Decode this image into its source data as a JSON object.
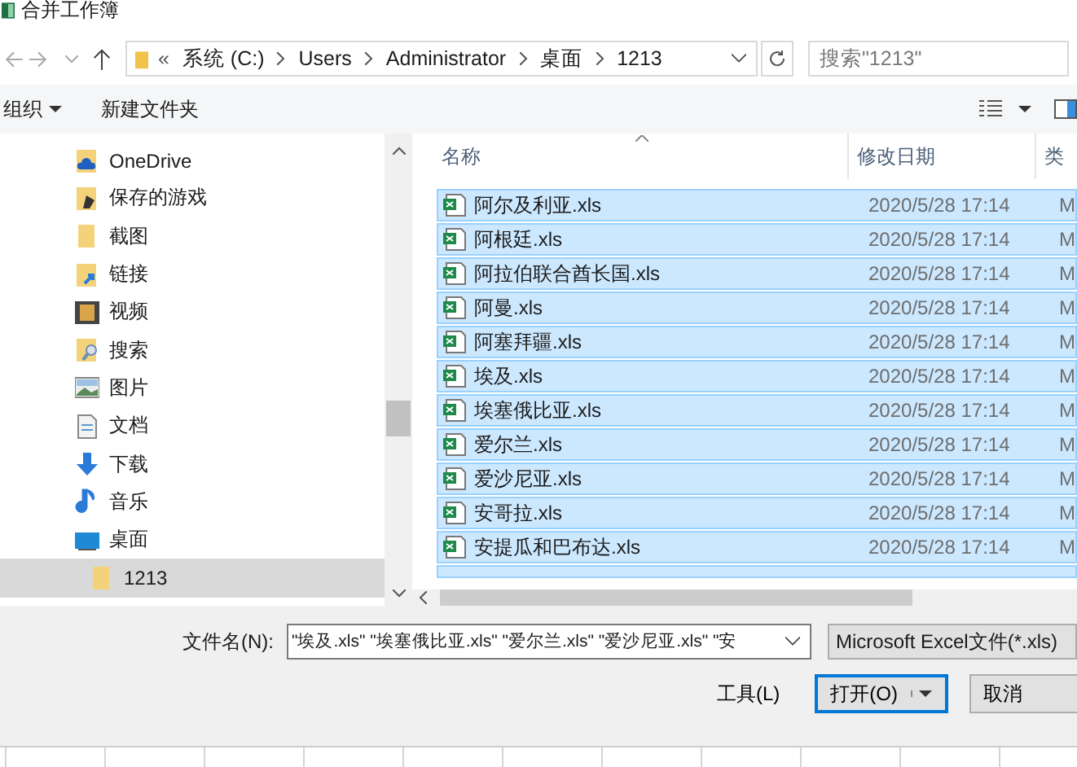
{
  "window": {
    "title": "合并工作簿"
  },
  "address": {
    "crumbs": [
      "«",
      "系统 (C:)",
      "Users",
      "Administrator",
      "桌面",
      "1213"
    ]
  },
  "search": {
    "placeholder": "搜索\"1213\""
  },
  "toolbar": {
    "organize": "组织",
    "new_folder": "新建文件夹"
  },
  "sidebar": {
    "items": [
      {
        "label": "OneDrive",
        "selected": false
      },
      {
        "label": "保存的游戏",
        "selected": false
      },
      {
        "label": "截图",
        "selected": false
      },
      {
        "label": "链接",
        "selected": false
      },
      {
        "label": "视频",
        "selected": false
      },
      {
        "label": "搜索",
        "selected": false
      },
      {
        "label": "图片",
        "selected": false
      },
      {
        "label": "文档",
        "selected": false
      },
      {
        "label": "下载",
        "selected": false
      },
      {
        "label": "音乐",
        "selected": false
      },
      {
        "label": "桌面",
        "selected": false,
        "children": [
          {
            "label": "1213",
            "selected": true
          }
        ]
      }
    ]
  },
  "table": {
    "columns": [
      "名称",
      "修改日期",
      "类"
    ],
    "rows": [
      {
        "name": "阿尔及利亚.xls",
        "date": "2020/5/28 17:14",
        "column_3": "M",
        "selected": true
      },
      {
        "name": "阿根廷.xls",
        "date": "2020/5/28 17:14",
        "column_3": "M",
        "selected": true
      },
      {
        "name": "阿拉伯联合酋长国.xls",
        "date": "2020/5/28 17:14",
        "column_3": "M",
        "selected": true
      },
      {
        "name": "阿曼.xls",
        "date": "2020/5/28 17:14",
        "column_3": "M",
        "selected": true
      },
      {
        "name": "阿塞拜疆.xls",
        "date": "2020/5/28 17:14",
        "column_3": "M",
        "selected": true
      },
      {
        "name": "埃及.xls",
        "date": "2020/5/28 17:14",
        "column_3": "M",
        "selected": true
      },
      {
        "name": "埃塞俄比亚.xls",
        "date": "2020/5/28 17:14",
        "column_3": "M",
        "selected": true
      },
      {
        "name": "爱尔兰.xls",
        "date": "2020/5/28 17:14",
        "column_3": "M",
        "selected": true
      },
      {
        "name": "爱沙尼亚.xls",
        "date": "2020/5/28 17:14",
        "column_3": "M",
        "selected": true
      },
      {
        "name": "安哥拉.xls",
        "date": "2020/5/28 17:14",
        "column_3": "M",
        "selected": true
      },
      {
        "name": "安提瓜和巴布达.xls",
        "date": "2020/5/28 17:14",
        "column_3": "M",
        "selected": true
      }
    ]
  },
  "filename": {
    "label": "文件名(N):",
    "value": "\"埃及.xls\" \"埃塞俄比亚.xls\" \"爱尔兰.xls\" \"爱沙尼亚.xls\" \"安"
  },
  "filter": {
    "value": "Microsoft Excel文件(*.xls)"
  },
  "tools": {
    "label": "工具(L)"
  },
  "buttons": [
    {
      "label": "打开(O)",
      "kind": "split"
    },
    {
      "label": "取消",
      "kind": "plain"
    }
  ]
}
